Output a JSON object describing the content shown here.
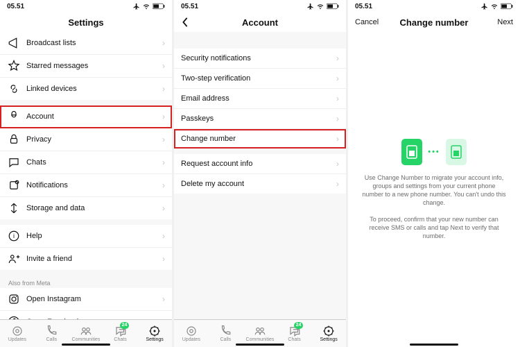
{
  "statusbar": {
    "time": "05.51"
  },
  "pane1": {
    "title": "Settings",
    "group1": [
      {
        "key": "broadcast",
        "label": "Broadcast lists"
      },
      {
        "key": "starred",
        "label": "Starred messages"
      },
      {
        "key": "linked",
        "label": "Linked devices"
      }
    ],
    "group2": [
      {
        "key": "account",
        "label": "Account",
        "highlight": true
      },
      {
        "key": "privacy",
        "label": "Privacy"
      },
      {
        "key": "chats",
        "label": "Chats"
      },
      {
        "key": "notifications",
        "label": "Notifications"
      },
      {
        "key": "storage",
        "label": "Storage and data"
      }
    ],
    "group3": [
      {
        "key": "help",
        "label": "Help"
      },
      {
        "key": "invite",
        "label": "Invite a friend"
      }
    ],
    "metaLabel": "Also from Meta",
    "group4": [
      {
        "key": "instagram",
        "label": "Open Instagram"
      },
      {
        "key": "facebook",
        "label": "Open Facebook"
      }
    ]
  },
  "pane2": {
    "title": "Account",
    "group1": [
      {
        "key": "security",
        "label": "Security notifications"
      },
      {
        "key": "twostep",
        "label": "Two-step verification"
      },
      {
        "key": "email",
        "label": "Email address"
      },
      {
        "key": "passkeys",
        "label": "Passkeys"
      },
      {
        "key": "changenumber",
        "label": "Change number",
        "highlight": true
      }
    ],
    "group2": [
      {
        "key": "requestinfo",
        "label": "Request account info"
      },
      {
        "key": "delete",
        "label": "Delete my account"
      }
    ]
  },
  "pane3": {
    "cancel": "Cancel",
    "title": "Change number",
    "next": "Next",
    "para1": "Use Change Number to migrate your account info, groups and settings from your current phone number to a new phone number. You can't undo this change.",
    "para2": "To proceed, confirm that your new number can receive SMS or calls and tap Next to verify that number."
  },
  "tabs": {
    "items": [
      "Updates",
      "Calls",
      "Communities",
      "Chats",
      "Settings"
    ],
    "badge": "24",
    "activeIndex": 4
  }
}
